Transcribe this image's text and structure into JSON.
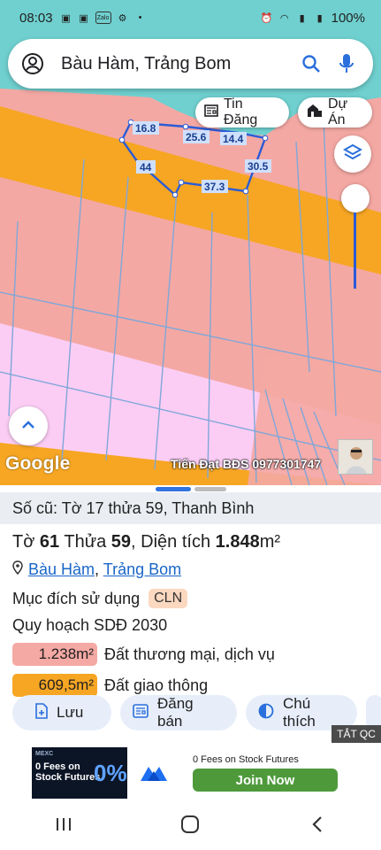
{
  "status_bar": {
    "time": "08:03",
    "battery": "100%",
    "app_badge": "Zalo"
  },
  "search": {
    "query": "Bàu Hàm, Trảng Bom"
  },
  "map": {
    "chips": {
      "news": "Tin Đăng",
      "project": "Dự Án"
    },
    "parcel_edges": [
      "16.8",
      "25.6",
      "14.4",
      "44",
      "37.3",
      "30.5"
    ],
    "google_logo": "Google",
    "watermark": "Tiến Đạt BĐS 0977301747",
    "colors": {
      "land_pink": "#f4a8a3",
      "road_orange": "#f6a623",
      "commerce_magenta": "#fbcdf5",
      "water_teal": "#6fd0cf",
      "boundary_blue": "#2a5bd7"
    }
  },
  "sheet": {
    "old_info": "Số cũ: Tờ 17 thửa 59, Thanh Bình",
    "parcel": {
      "to_label": "Tờ",
      "to_value": "61",
      "thua_label": "Thửa",
      "thua_value": "59",
      "area_label": "Diện tích",
      "area_value": "1.848",
      "area_unit": "m²"
    },
    "location": {
      "commune": "Bàu Hàm",
      "separator": ",",
      "district": "Trảng Bom"
    },
    "purpose": {
      "label": "Mục đích sử dụng",
      "code": "CLN"
    },
    "plan_title": "Quy hoạch SDĐ 2030",
    "plan_items": [
      {
        "area": "1.238m²",
        "label": "Đất thương mại, dịch vụ",
        "color": "#f4a9a4"
      },
      {
        "area": "609,5m²",
        "label": "Đất giao thông",
        "color": "#f6a623"
      }
    ],
    "actions": {
      "save": "Lưu",
      "sell": "Đăng bán",
      "note": "Chú thích"
    },
    "hide_ads": "TẮT QC"
  },
  "ad": {
    "brand": "MEXC",
    "image_lines": [
      "0 Fees on",
      "Stock Futures"
    ],
    "image_big": "0%",
    "title": "0 Fees on Stock Futures",
    "cta": "Join Now"
  }
}
